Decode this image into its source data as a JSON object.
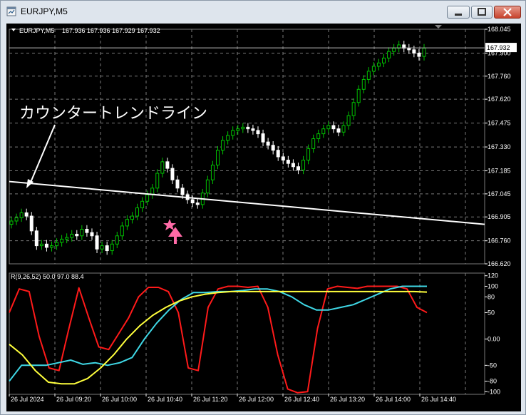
{
  "window": {
    "title": "EURJPY,M5"
  },
  "colors": {
    "background": "#000000",
    "grid": "#7a7a7a",
    "bull_candle": "#00c000",
    "bear_candle": "#ffffff",
    "trendline": "#ffffff",
    "arrow": "#ff6aa6",
    "osc_red": "#ff1a1a",
    "osc_cyan": "#3fd8e6",
    "osc_yellow": "#ffff3c"
  },
  "icons": [
    "window-icon",
    "minimize-icon",
    "maximize-icon",
    "close-icon",
    "arrow-up-icon",
    "star-icon"
  ],
  "chart_data": [
    {
      "type": "candlestick",
      "symbol_label": "EURJPY,M5",
      "ohlc_label": "167.936 167.936 167.929 167.932",
      "annotation": "カウンタートレンドライン",
      "current_price_label": "167.932",
      "ylim": [
        166.62,
        168.045
      ],
      "y_ticks": [
        "168.045",
        "167.900",
        "167.760",
        "167.620",
        "167.475",
        "167.330",
        "167.185",
        "167.045",
        "166.905",
        "166.760",
        "166.620"
      ],
      "x_ticks": [
        "26 Jul 2024",
        "26 Jul 09:20",
        "26 Jul 10:00",
        "26 Jul 10:40",
        "26 Jul 11:20",
        "26 Jul 12:00",
        "26 Jul 12:40",
        "26 Jul 13:20",
        "26 Jul 14:00",
        "26 Jul 14:40"
      ],
      "closes": [
        166.88,
        166.9,
        166.93,
        166.91,
        166.82,
        166.73,
        166.74,
        166.72,
        166.73,
        166.75,
        166.77,
        166.78,
        166.8,
        166.79,
        166.83,
        166.81,
        166.79,
        166.71,
        166.73,
        166.7,
        166.74,
        166.79,
        166.85,
        166.89,
        166.91,
        166.96,
        167.0,
        167.04,
        167.08,
        167.17,
        167.24,
        167.2,
        167.13,
        167.08,
        167.04,
        167.01,
        166.99,
        166.98,
        167.05,
        167.13,
        167.22,
        167.31,
        167.37,
        167.4,
        167.43,
        167.44,
        167.45,
        167.44,
        167.43,
        167.41,
        167.36,
        167.34,
        167.31,
        167.27,
        167.25,
        167.23,
        167.21,
        167.19,
        167.25,
        167.32,
        167.38,
        167.41,
        167.44,
        167.46,
        167.44,
        167.42,
        167.46,
        167.52,
        167.6,
        167.68,
        167.74,
        167.79,
        167.82,
        167.84,
        167.87,
        167.91,
        167.93,
        167.95,
        167.93,
        167.92,
        167.9,
        167.88,
        167.93
      ],
      "trendline": {
        "start": 167.12,
        "end": 166.86
      }
    },
    {
      "type": "line",
      "indicator_label": "R(9,26,52) 50.0 97.0 88.4",
      "ylim": [
        -105,
        125
      ],
      "y_ticks": [
        "120",
        "100",
        "80",
        "50",
        "0.00",
        "-50",
        "-80",
        "-100"
      ],
      "series": [
        {
          "values": [
            50,
            95,
            90,
            5,
            -55,
            -60,
            20,
            97,
            40,
            -15,
            -20,
            10,
            40,
            80,
            98,
            98,
            90,
            50,
            -55,
            -60,
            60,
            95,
            100,
            100,
            98,
            100,
            60,
            -30,
            -95,
            -102,
            -100,
            20,
            95,
            100,
            98,
            96,
            100,
            100,
            100,
            100,
            95,
            60,
            50
          ]
        },
        {
          "values": [
            -80,
            -50,
            -50,
            -50,
            -45,
            -40,
            -48,
            -45,
            -50,
            -45,
            -35,
            0,
            30,
            55,
            75,
            88,
            88,
            90,
            90,
            92,
            95,
            95,
            90,
            80,
            65,
            55,
            55,
            60,
            65,
            75,
            85,
            95,
            100,
            100,
            100
          ]
        },
        {
          "values": [
            -10,
            -30,
            -60,
            -82,
            -85,
            -85,
            -75,
            -55,
            -30,
            0,
            25,
            45,
            60,
            72,
            80,
            85,
            88,
            90,
            90,
            90,
            90,
            90,
            90,
            90,
            90,
            90,
            90,
            90,
            90,
            90,
            90,
            90,
            89
          ]
        }
      ]
    }
  ]
}
